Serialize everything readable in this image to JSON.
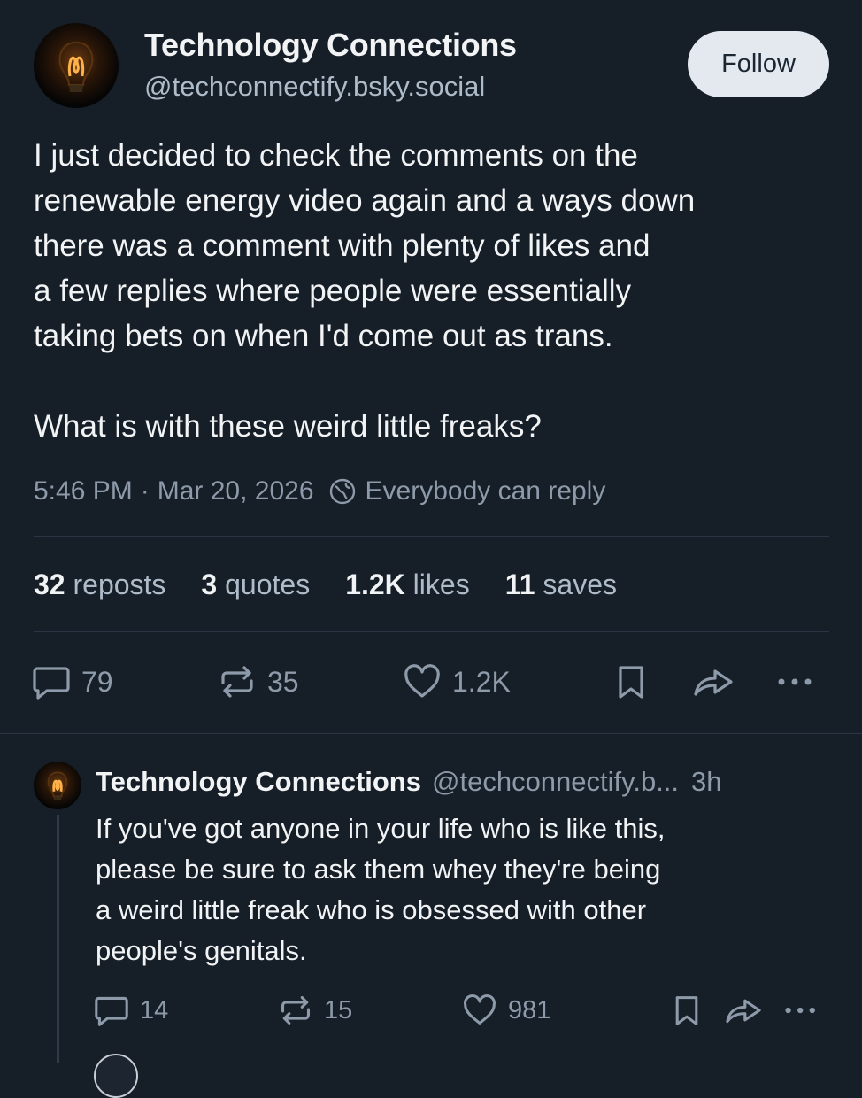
{
  "post": {
    "author": {
      "name": "Technology Connections",
      "handle": "@techconnectify.bsky.social",
      "avatar_icon": "lightbulb-filament-avatar"
    },
    "follow_label": "Follow",
    "text_lines": [
      "I just decided to check the comments on the",
      "renewable energy video again and a ways down",
      "there was a comment with plenty of likes and",
      "a few replies where people were essentially",
      "taking bets on when I'd come out as trans."
    ],
    "text_line_2": "What is with these weird little freaks?",
    "time": "5:46 PM",
    "separator": "·",
    "date": "Mar 20, 2026",
    "reply_setting": "Everybody can reply",
    "reply_setting_icon": "globe-icon",
    "stats": {
      "reposts_count": "32",
      "reposts_label": "reposts",
      "quotes_count": "3",
      "quotes_label": "quotes",
      "likes_count": "1.2K",
      "likes_label": "likes",
      "saves_count": "11",
      "saves_label": "saves"
    },
    "actions": {
      "replies": "79",
      "reposts": "35",
      "likes": "1.2K"
    }
  },
  "reply": {
    "author_name": "Technology Connections",
    "author_handle": "@techconnectify.b...",
    "time": "3h",
    "text_lines": [
      "If you've got anyone in your life who is like this,",
      "please be sure to ask them whey they're being",
      "a weird little freak who is obsessed with other",
      "people's genitals."
    ],
    "actions": {
      "replies": "14",
      "reposts": "15",
      "likes": "981"
    }
  },
  "colors": {
    "background": "#161e27",
    "text_primary": "#f1f3f5",
    "text_secondary": "#8d9aa9",
    "follow_button_bg": "#e3e9ef",
    "divider": "#2a3644"
  }
}
